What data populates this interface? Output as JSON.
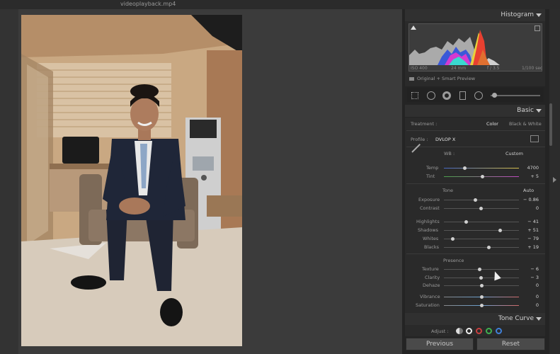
{
  "window": {
    "filename": "videoplayback.mp4"
  },
  "histogram": {
    "title": "Histogram",
    "exif": {
      "iso": "ISO 400",
      "focal": "24 mm",
      "aperture": "f / 3.5",
      "shutter": "1/100 sec"
    },
    "preview_label": "Original + Smart Preview"
  },
  "basic": {
    "title": "Basic",
    "treatment_label": "Treatment :",
    "treatment_color": "Color",
    "treatment_bw": "Black & White",
    "profile_label": "Profile :",
    "profile_value": "DVLOP X",
    "wb_label": "WB :",
    "wb_value": "Custom",
    "temp": {
      "label": "Temp",
      "value": "4700",
      "position": 0.35
    },
    "tint": {
      "label": "Tint",
      "value": "+ 5",
      "position": 0.52
    },
    "tone_label": "Tone",
    "auto_label": "Auto",
    "tone": [
      {
        "label": "Exposure",
        "value": "− 0.86",
        "position": 0.44
      },
      {
        "label": "Contrast",
        "value": "0",
        "position": 0.5
      }
    ],
    "tone2": [
      {
        "label": "Highlights",
        "value": "− 41",
        "position": 0.3
      },
      {
        "label": "Shadows",
        "value": "+ 51",
        "position": 0.75
      },
      {
        "label": "Whites",
        "value": "− 79",
        "position": 0.1
      },
      {
        "label": "Blacks",
        "value": "+ 19",
        "position": 0.6
      }
    ],
    "presence_label": "Presence",
    "presence": [
      {
        "label": "Texture",
        "value": "− 6",
        "position": 0.47
      },
      {
        "label": "Clarity",
        "value": "− 3",
        "position": 0.49
      },
      {
        "label": "Dehaze",
        "value": "0",
        "position": 0.5
      }
    ],
    "presence2": [
      {
        "label": "Vibrance",
        "value": "0",
        "position": 0.5
      },
      {
        "label": "Saturation",
        "value": "0",
        "position": 0.5
      }
    ]
  },
  "tone_curve": {
    "title": "Tone Curve",
    "adjust_label": "Adjust :"
  },
  "buttons": {
    "previous": "Previous",
    "reset": "Reset"
  },
  "colors": {
    "panel_bg": "#242424",
    "header_bg": "#303030",
    "viewer_bg": "#3b3b3b"
  }
}
